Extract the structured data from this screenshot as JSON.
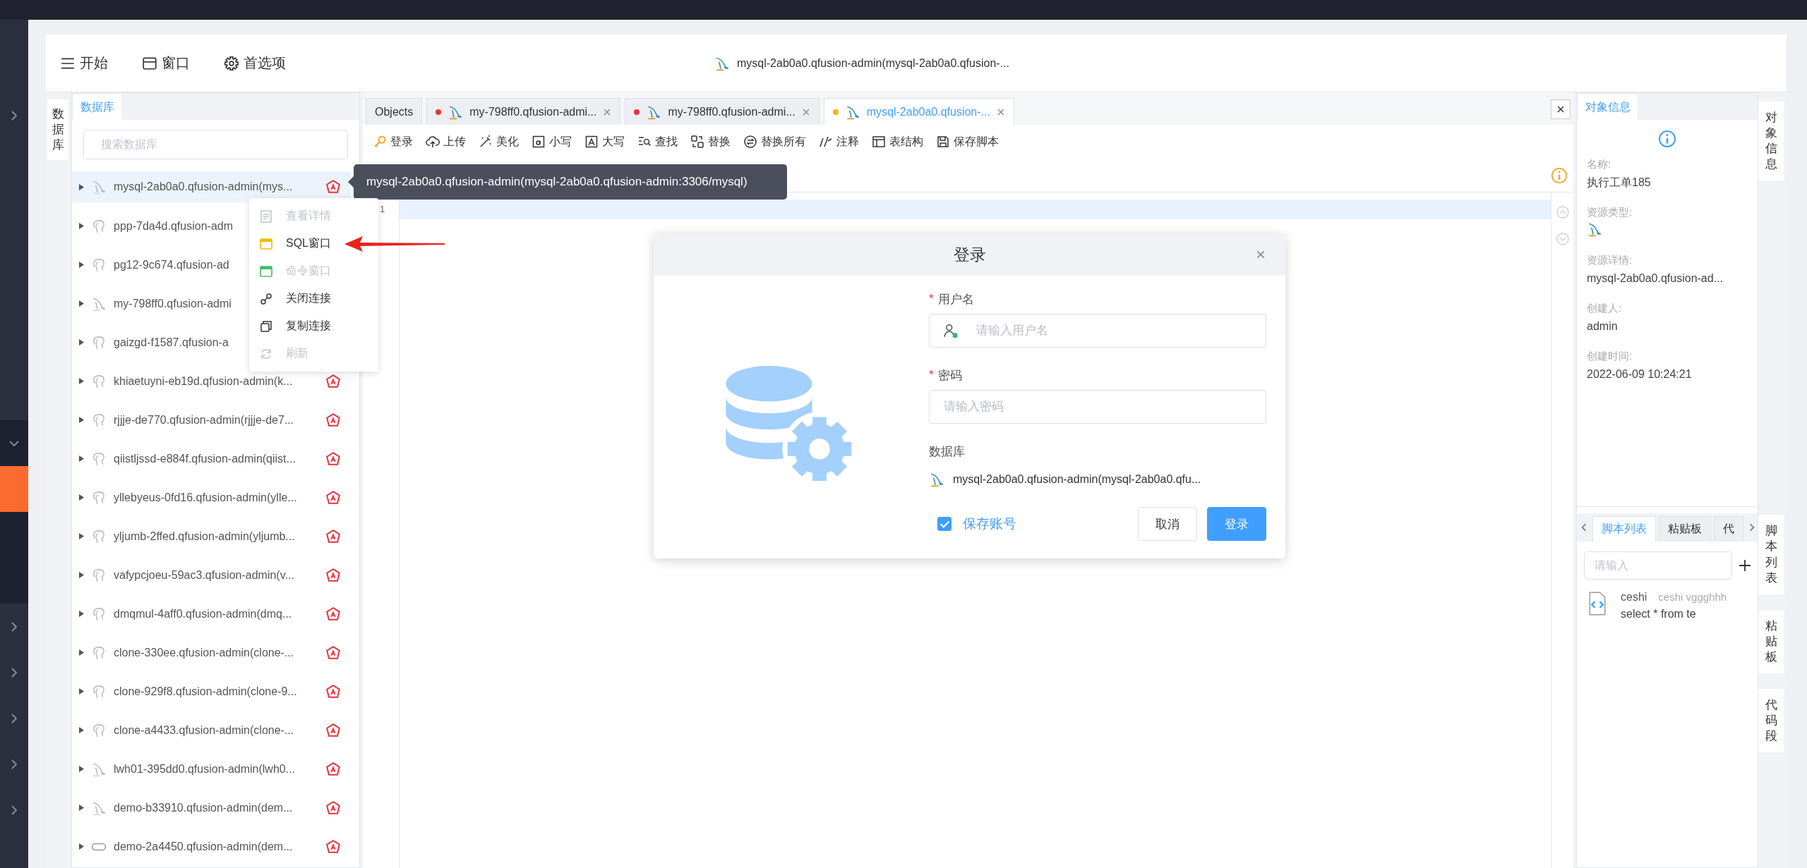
{
  "side_nav": {
    "items": [
      {
        "kind": "group"
      },
      {
        "kind": "group-open"
      },
      {
        "kind": "child",
        "selected": true
      },
      {
        "kind": "child",
        "selected": false
      },
      {
        "kind": "child",
        "selected": false
      },
      {
        "kind": "group"
      },
      {
        "kind": "group"
      },
      {
        "kind": "group"
      },
      {
        "kind": "group"
      },
      {
        "kind": "group"
      }
    ]
  },
  "top_menu": [
    {
      "kind": "menu",
      "label": "开始"
    },
    {
      "kind": "window",
      "label": "窗口"
    },
    {
      "kind": "settings",
      "label": "首选项"
    }
  ],
  "connection_title": "mysql-2ab0a0.qfusion-admin(mysql-2ab0a0.qfusion-...",
  "left_dock": {
    "tabs": [
      {
        "label": "数据库",
        "selected": true
      }
    ]
  },
  "database_panel": {
    "tabs": [
      {
        "label": "数据库",
        "selected": true
      }
    ],
    "search": {
      "placeholder": "搜索数据库"
    },
    "items": [
      {
        "kind": "mysql",
        "name": "mysql-2ab0a0.qfusion-admin(mys...",
        "selected": true,
        "badge": true
      },
      {
        "kind": "postgres",
        "name": "ppp-7da4d.qfusion-adm",
        "selected": false,
        "badge": false
      },
      {
        "kind": "postgres",
        "name": "pg12-9c674.qfusion-ad",
        "selected": false,
        "badge": false
      },
      {
        "kind": "mysql",
        "name": "my-798ff0.qfusion-admi",
        "selected": false,
        "badge": false
      },
      {
        "kind": "postgres",
        "name": "gaizgd-f1587.qfusion-a",
        "selected": false,
        "badge": false
      },
      {
        "kind": "postgres",
        "name": "khiaetuyni-eb19d.qfusion-admin(k...",
        "selected": false,
        "badge": true
      },
      {
        "kind": "postgres",
        "name": "rjjje-de770.qfusion-admin(rjjje-de7...",
        "selected": false,
        "badge": true
      },
      {
        "kind": "postgres",
        "name": "qiistljssd-e884f.qfusion-admin(qiist...",
        "selected": false,
        "badge": true
      },
      {
        "kind": "postgres",
        "name": "yllebyeus-0fd16.qfusion-admin(ylle...",
        "selected": false,
        "badge": true
      },
      {
        "kind": "postgres",
        "name": "yljumb-2ffed.qfusion-admin(yljumb...",
        "selected": false,
        "badge": true
      },
      {
        "kind": "postgres",
        "name": "vafypcjoeu-59ac3.qfusion-admin(v...",
        "selected": false,
        "badge": true
      },
      {
        "kind": "postgres",
        "name": "dmqmul-4aff0.qfusion-admin(dmq...",
        "selected": false,
        "badge": true
      },
      {
        "kind": "postgres",
        "name": "clone-330ee.qfusion-admin(clone-...",
        "selected": false,
        "badge": true
      },
      {
        "kind": "postgres",
        "name": "clone-929f8.qfusion-admin(clone-9...",
        "selected": false,
        "badge": true
      },
      {
        "kind": "postgres",
        "name": "clone-a4433.qfusion-admin(clone-...",
        "selected": false,
        "badge": true
      },
      {
        "kind": "mysql",
        "name": "lwh01-395dd0.qfusion-admin(lwh0...",
        "selected": false,
        "badge": true
      },
      {
        "kind": "mysql",
        "name": "demo-b33910.qfusion-admin(dem...",
        "selected": false,
        "badge": true
      },
      {
        "kind": "other",
        "name": "demo-2a4450.qfusion-admin(dem...",
        "selected": false,
        "badge": true
      }
    ]
  },
  "tooltip": "mysql-2ab0a0.qfusion-admin(mysql-2ab0a0.qfusion-admin:3306/mysql)",
  "context_menu": {
    "items": [
      {
        "kind": "detail",
        "label": "查看详情",
        "disabled": true
      },
      {
        "kind": "sql",
        "label": "SQL窗口",
        "disabled": false
      },
      {
        "kind": "command",
        "label": "命令窗口",
        "disabled": true
      },
      {
        "kind": "disconnect",
        "label": "关闭连接",
        "disabled": false
      },
      {
        "kind": "copy",
        "label": "复制连接",
        "disabled": false
      },
      {
        "kind": "refresh",
        "label": "刷新",
        "disabled": true
      }
    ]
  },
  "editor": {
    "tabs": [
      {
        "kind": "objects",
        "label": "Objects",
        "selected": false
      },
      {
        "kind": "mysql",
        "label": "my-798ff0.qfusion-admi...",
        "color": "#e8323c",
        "selected": false
      },
      {
        "kind": "mysql",
        "label": "my-798ff0.qfusion-admi...",
        "color": "#e8323c",
        "selected": false
      },
      {
        "kind": "mysql",
        "label": "mysql-2ab0a0.qfusion-...",
        "color": "#f5b800",
        "selected": true
      }
    ],
    "toolbar": [
      {
        "kind": "login",
        "label": "登录"
      },
      {
        "kind": "upload",
        "label": "上传"
      },
      {
        "kind": "beautify",
        "label": "美化"
      },
      {
        "kind": "lowercase",
        "label": "小写"
      },
      {
        "kind": "uppercase",
        "label": "大写"
      },
      {
        "kind": "find",
        "label": "查找"
      },
      {
        "kind": "replace",
        "label": "替换"
      },
      {
        "kind": "replace-all",
        "label": "替换所有"
      },
      {
        "kind": "comment",
        "label": "注释"
      },
      {
        "kind": "table",
        "label": "表结构"
      },
      {
        "kind": "save",
        "label": "保存脚本"
      }
    ],
    "line_numbers": [
      "1"
    ]
  },
  "dialog": {
    "title": "登录",
    "username": {
      "required_mark": "*",
      "label": "用户名",
      "placeholder": "请输入用户名"
    },
    "password": {
      "required_mark": "*",
      "label": "密码",
      "placeholder": "请输入密码"
    },
    "database": {
      "label": "数据库",
      "value": "mysql-2ab0a0.qfusion-admin(mysql-2ab0a0.qfu..."
    },
    "remember": {
      "label": "保存账号",
      "checked": true
    },
    "buttons": [
      {
        "kind": "secondary",
        "label": "取消"
      },
      {
        "kind": "primary",
        "label": "登录"
      }
    ]
  },
  "object_info": {
    "tabs": [
      {
        "label": "对象信息",
        "selected": true
      }
    ],
    "fields": [
      {
        "kind": "text",
        "label": "名称:",
        "value": "执行工单185"
      },
      {
        "kind": "icon",
        "label": "资源类型:"
      },
      {
        "kind": "text",
        "label": "资源详情:",
        "value": "mysql-2ab0a0.qfusion-ad..."
      },
      {
        "kind": "text",
        "label": "创建人:",
        "value": "admin"
      },
      {
        "kind": "text",
        "label": "创建时间:",
        "value": "2022-06-09 10:24:21"
      }
    ]
  },
  "script_panel": {
    "tabs": [
      {
        "label": "脚本列表",
        "selected": true
      },
      {
        "label": "粘贴板",
        "selected": false
      },
      {
        "label": "代",
        "selected": false
      }
    ],
    "search": {
      "placeholder": "请输入"
    },
    "scripts": [
      {
        "name": "ceshi",
        "description": "ceshi vggghhh",
        "preview": "select * from te"
      }
    ]
  },
  "right_dock": {
    "tabs": [
      "对象信息",
      "脚本列表",
      "粘贴板",
      "代码段"
    ]
  }
}
